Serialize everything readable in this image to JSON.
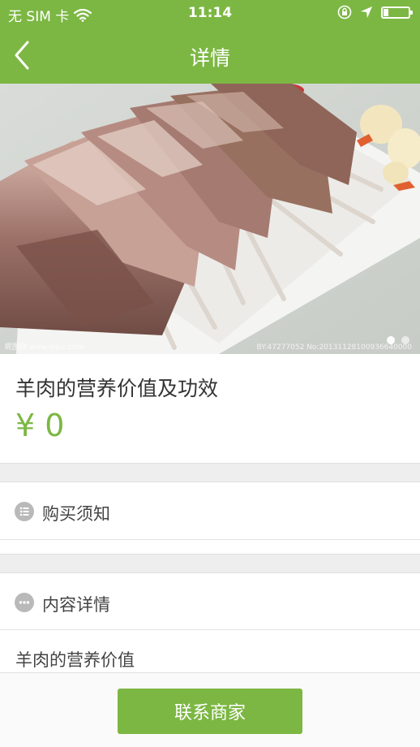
{
  "status_bar": {
    "carrier": "无 SIM 卡",
    "time": "11:14",
    "battery_level": 0.2
  },
  "nav": {
    "title": "详情",
    "back_icon": "chevron-left-icon"
  },
  "hero": {
    "page_count": 2,
    "current_page": 1,
    "watermark_left": "昵图网 www.nipic.com",
    "watermark_right": "BY:47277052 No:20131128100936640000"
  },
  "product": {
    "title": "羊肉的营养价值及功效",
    "price": "¥ 0"
  },
  "sections": {
    "purchase_notice": {
      "label": "购买须知",
      "icon": "list-icon"
    },
    "content_details": {
      "label": "内容详情",
      "icon": "more-icon"
    }
  },
  "content": {
    "text": "羊肉的营养价值"
  },
  "actions": {
    "contact_merchant": "联系商家"
  },
  "colors": {
    "brand_green": "#7cb743",
    "gap_gray": "#eeeeee",
    "icon_gray": "#b9b9b9"
  }
}
